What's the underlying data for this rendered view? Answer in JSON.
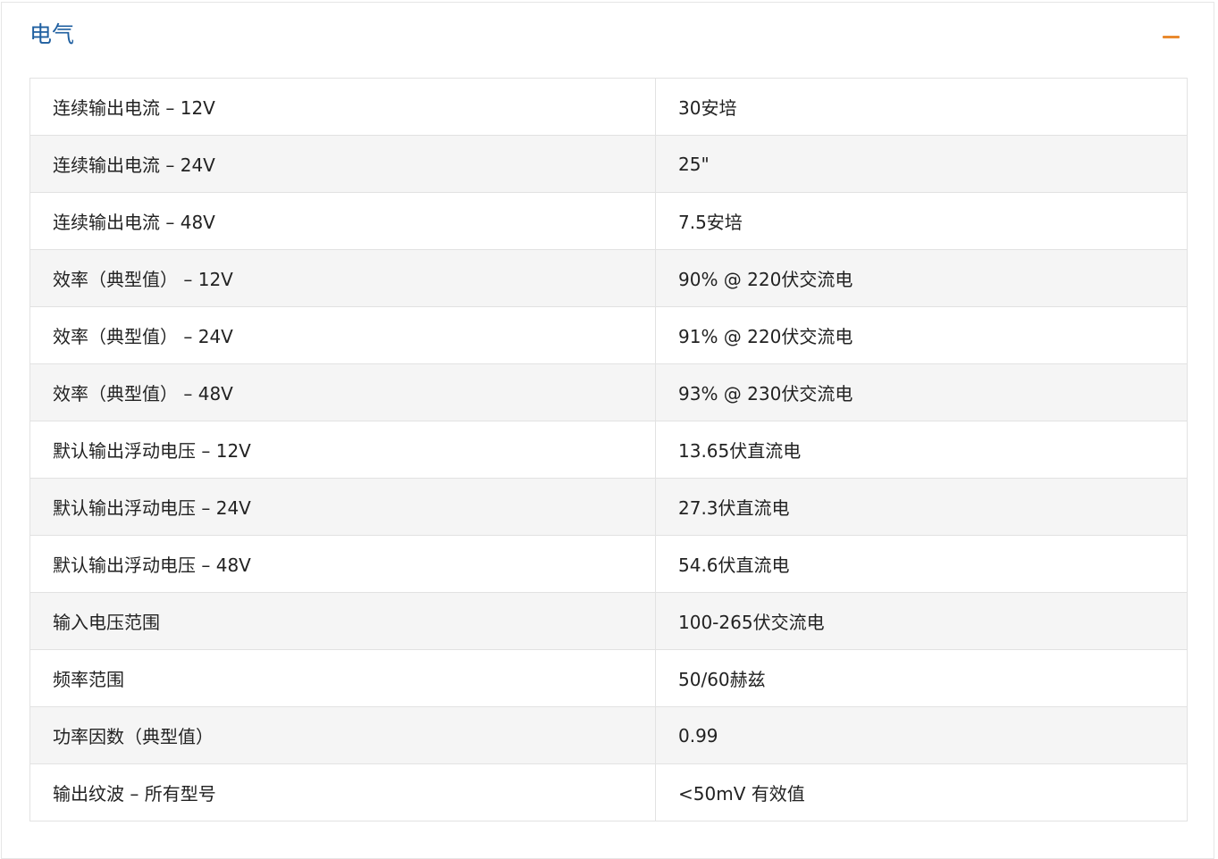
{
  "section": {
    "title": "电气",
    "collapse_icon": "minus-icon",
    "accent_color": "#e98a2f",
    "title_color": "#1f5fa0"
  },
  "specs": [
    {
      "label": "连续输出电流 – 12V",
      "value": "30安培"
    },
    {
      "label": "连续输出电流 – 24V",
      "value": "25\""
    },
    {
      "label": "连续输出电流 – 48V",
      "value": "7.5安培"
    },
    {
      "label": "效率（典型值） – 12V",
      "value": "90% @ 220伏交流电"
    },
    {
      "label": "效率（典型值） – 24V",
      "value": "91% @ 220伏交流电"
    },
    {
      "label": "效率（典型值） – 48V",
      "value": "93% @ 230伏交流电"
    },
    {
      "label": "默认输出浮动电压 – 12V",
      "value": "13.65伏直流电"
    },
    {
      "label": "默认输出浮动电压 – 24V",
      "value": "27.3伏直流电"
    },
    {
      "label": "默认输出浮动电压 – 48V",
      "value": "54.6伏直流电"
    },
    {
      "label": "输入电压范围",
      "value": "100-265伏交流电"
    },
    {
      "label": "频率范围",
      "value": "50/60赫兹"
    },
    {
      "label": "功率因数（典型值）",
      "value": "0.99"
    },
    {
      "label": "输出纹波 – 所有型号",
      "value": "<50mV 有效值"
    }
  ]
}
